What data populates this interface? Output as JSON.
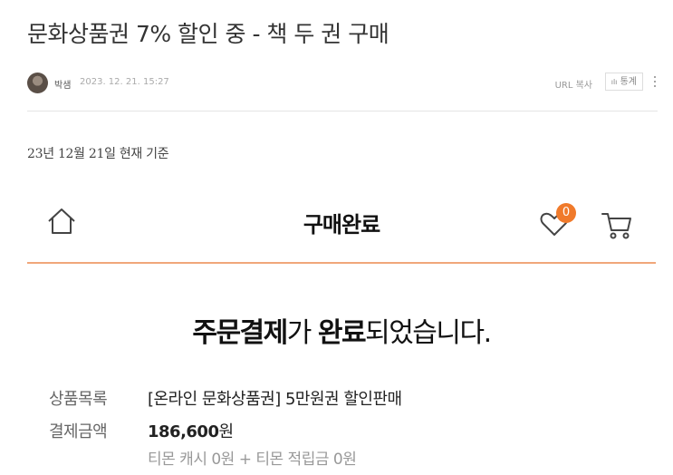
{
  "post": {
    "title": "문화상품권 7% 할인 중 - 책 두 권 구매",
    "author": "박샘",
    "date": "2023. 12. 21. 15:27",
    "url_copy": "URL 복사",
    "stats": "통계",
    "body_line": "23년 12월 21일 현재 기준"
  },
  "screenshot": {
    "header_title": "구매완료",
    "wishlist_count": "0",
    "message": {
      "part1_bold": "주문결제",
      "part2": "가 ",
      "part3_bold": "완료",
      "part4": "되었습니다."
    },
    "rows": [
      {
        "label": "상품목록",
        "value": "[온라인 문화상품권] 5만원권 할인판매"
      },
      {
        "label": "결제금액",
        "amount": "186,600",
        "unit": "원"
      }
    ],
    "sub_note": "티몬 캐시 0원 + 티몬 적립금 0원",
    "accent_color": "#f07a2b"
  }
}
